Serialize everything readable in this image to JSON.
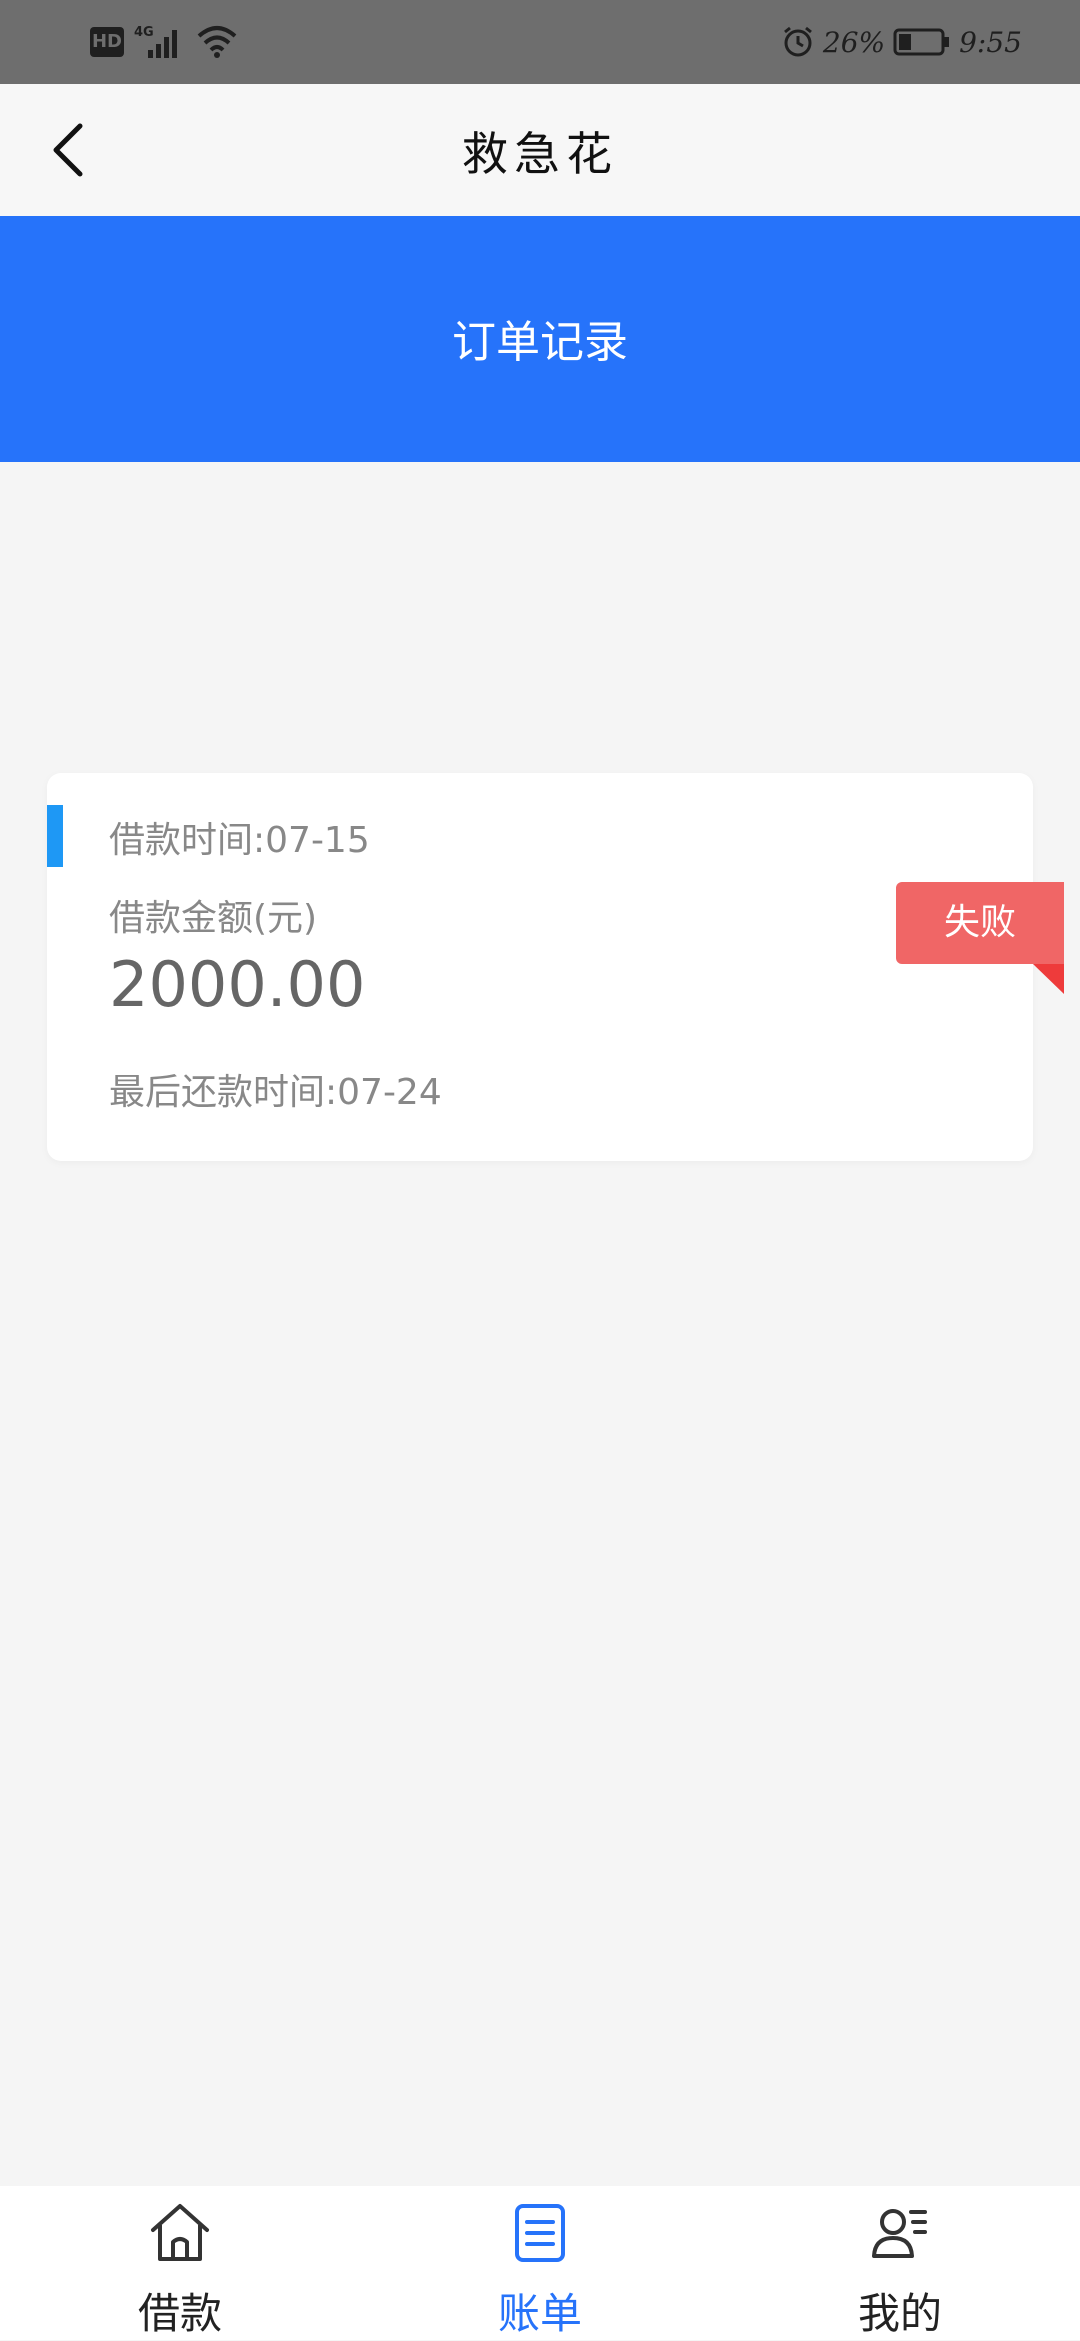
{
  "status_bar": {
    "left_icons": [
      "hd-icon",
      "signal-4g-icon",
      "wifi-icon"
    ],
    "hd_label": "HD",
    "network_label": "4G",
    "battery_percent": "26%",
    "time": "9:55",
    "right_icons": [
      "alarm-icon",
      "battery-icon"
    ]
  },
  "nav": {
    "back_icon": "back-chevron-icon",
    "title": "救急花"
  },
  "header": {
    "title": "订单记录",
    "color": "#2673fa"
  },
  "order": {
    "loan_time_label": "借款时间:07-15",
    "amount_label": "借款金额(元)",
    "amount": "2000.00",
    "last_repay_label": "最后还款时间:07-24",
    "status": "失败",
    "status_color": "#f06666"
  },
  "tabs": [
    {
      "label": "借款",
      "icon": "home-icon",
      "active": false
    },
    {
      "label": "账单",
      "icon": "bill-icon",
      "active": true
    },
    {
      "label": "我的",
      "icon": "profile-icon",
      "active": false
    }
  ]
}
